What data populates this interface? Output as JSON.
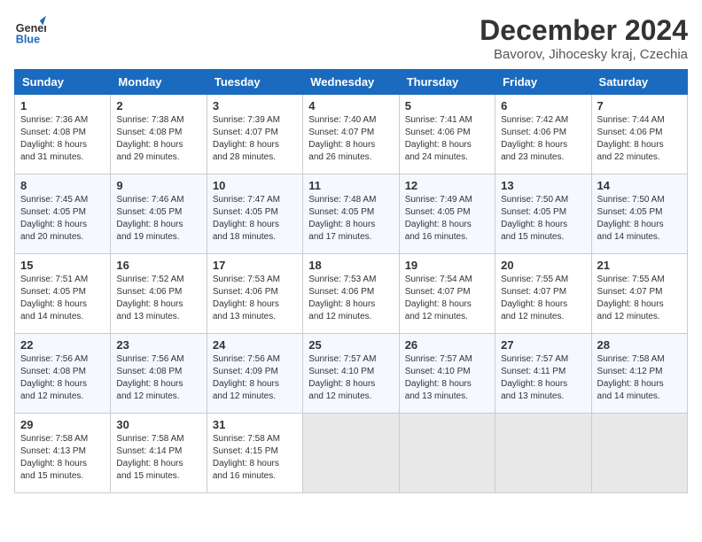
{
  "logo": {
    "line1": "General",
    "line2": "Blue"
  },
  "title": "December 2024",
  "location": "Bavorov, Jihocesky kraj, Czechia",
  "weekdays": [
    "Sunday",
    "Monday",
    "Tuesday",
    "Wednesday",
    "Thursday",
    "Friday",
    "Saturday"
  ],
  "weeks": [
    [
      {
        "day": 1,
        "info": "Sunrise: 7:36 AM\nSunset: 4:08 PM\nDaylight: 8 hours\nand 31 minutes."
      },
      {
        "day": 2,
        "info": "Sunrise: 7:38 AM\nSunset: 4:08 PM\nDaylight: 8 hours\nand 29 minutes."
      },
      {
        "day": 3,
        "info": "Sunrise: 7:39 AM\nSunset: 4:07 PM\nDaylight: 8 hours\nand 28 minutes."
      },
      {
        "day": 4,
        "info": "Sunrise: 7:40 AM\nSunset: 4:07 PM\nDaylight: 8 hours\nand 26 minutes."
      },
      {
        "day": 5,
        "info": "Sunrise: 7:41 AM\nSunset: 4:06 PM\nDaylight: 8 hours\nand 24 minutes."
      },
      {
        "day": 6,
        "info": "Sunrise: 7:42 AM\nSunset: 4:06 PM\nDaylight: 8 hours\nand 23 minutes."
      },
      {
        "day": 7,
        "info": "Sunrise: 7:44 AM\nSunset: 4:06 PM\nDaylight: 8 hours\nand 22 minutes."
      }
    ],
    [
      {
        "day": 8,
        "info": "Sunrise: 7:45 AM\nSunset: 4:05 PM\nDaylight: 8 hours\nand 20 minutes."
      },
      {
        "day": 9,
        "info": "Sunrise: 7:46 AM\nSunset: 4:05 PM\nDaylight: 8 hours\nand 19 minutes."
      },
      {
        "day": 10,
        "info": "Sunrise: 7:47 AM\nSunset: 4:05 PM\nDaylight: 8 hours\nand 18 minutes."
      },
      {
        "day": 11,
        "info": "Sunrise: 7:48 AM\nSunset: 4:05 PM\nDaylight: 8 hours\nand 17 minutes."
      },
      {
        "day": 12,
        "info": "Sunrise: 7:49 AM\nSunset: 4:05 PM\nDaylight: 8 hours\nand 16 minutes."
      },
      {
        "day": 13,
        "info": "Sunrise: 7:50 AM\nSunset: 4:05 PM\nDaylight: 8 hours\nand 15 minutes."
      },
      {
        "day": 14,
        "info": "Sunrise: 7:50 AM\nSunset: 4:05 PM\nDaylight: 8 hours\nand 14 minutes."
      }
    ],
    [
      {
        "day": 15,
        "info": "Sunrise: 7:51 AM\nSunset: 4:05 PM\nDaylight: 8 hours\nand 14 minutes."
      },
      {
        "day": 16,
        "info": "Sunrise: 7:52 AM\nSunset: 4:06 PM\nDaylight: 8 hours\nand 13 minutes."
      },
      {
        "day": 17,
        "info": "Sunrise: 7:53 AM\nSunset: 4:06 PM\nDaylight: 8 hours\nand 13 minutes."
      },
      {
        "day": 18,
        "info": "Sunrise: 7:53 AM\nSunset: 4:06 PM\nDaylight: 8 hours\nand 12 minutes."
      },
      {
        "day": 19,
        "info": "Sunrise: 7:54 AM\nSunset: 4:07 PM\nDaylight: 8 hours\nand 12 minutes."
      },
      {
        "day": 20,
        "info": "Sunrise: 7:55 AM\nSunset: 4:07 PM\nDaylight: 8 hours\nand 12 minutes."
      },
      {
        "day": 21,
        "info": "Sunrise: 7:55 AM\nSunset: 4:07 PM\nDaylight: 8 hours\nand 12 minutes."
      }
    ],
    [
      {
        "day": 22,
        "info": "Sunrise: 7:56 AM\nSunset: 4:08 PM\nDaylight: 8 hours\nand 12 minutes."
      },
      {
        "day": 23,
        "info": "Sunrise: 7:56 AM\nSunset: 4:08 PM\nDaylight: 8 hours\nand 12 minutes."
      },
      {
        "day": 24,
        "info": "Sunrise: 7:56 AM\nSunset: 4:09 PM\nDaylight: 8 hours\nand 12 minutes."
      },
      {
        "day": 25,
        "info": "Sunrise: 7:57 AM\nSunset: 4:10 PM\nDaylight: 8 hours\nand 12 minutes."
      },
      {
        "day": 26,
        "info": "Sunrise: 7:57 AM\nSunset: 4:10 PM\nDaylight: 8 hours\nand 13 minutes."
      },
      {
        "day": 27,
        "info": "Sunrise: 7:57 AM\nSunset: 4:11 PM\nDaylight: 8 hours\nand 13 minutes."
      },
      {
        "day": 28,
        "info": "Sunrise: 7:58 AM\nSunset: 4:12 PM\nDaylight: 8 hours\nand 14 minutes."
      }
    ],
    [
      {
        "day": 29,
        "info": "Sunrise: 7:58 AM\nSunset: 4:13 PM\nDaylight: 8 hours\nand 15 minutes."
      },
      {
        "day": 30,
        "info": "Sunrise: 7:58 AM\nSunset: 4:14 PM\nDaylight: 8 hours\nand 15 minutes."
      },
      {
        "day": 31,
        "info": "Sunrise: 7:58 AM\nSunset: 4:15 PM\nDaylight: 8 hours\nand 16 minutes."
      },
      null,
      null,
      null,
      null
    ]
  ]
}
